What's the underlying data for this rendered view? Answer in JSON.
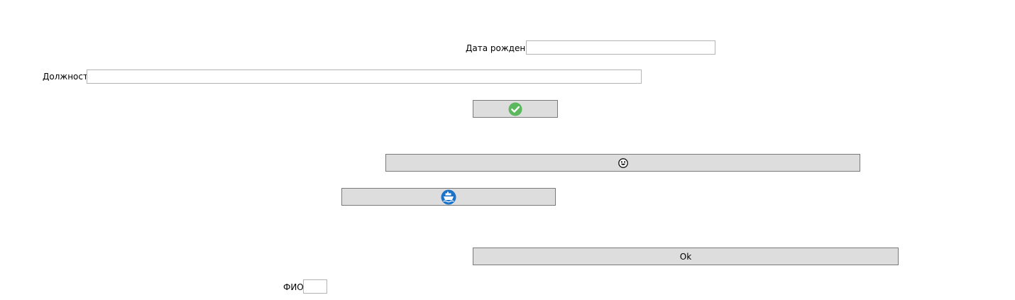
{
  "form": {
    "birth_date": {
      "label": "Дата рождения",
      "value": ""
    },
    "position": {
      "label": "Должность",
      "value": ""
    },
    "full_name": {
      "label": "ФИО",
      "value": ""
    }
  },
  "buttons": {
    "confirm": {
      "icon": "check-circle-icon",
      "icon_color": "#5cb85c"
    },
    "emoji": {
      "icon": "smiley-face-icon"
    },
    "ship": {
      "icon": "ship-icon",
      "icon_color": "#1a73c9"
    },
    "ok": {
      "label": "Ok"
    }
  }
}
